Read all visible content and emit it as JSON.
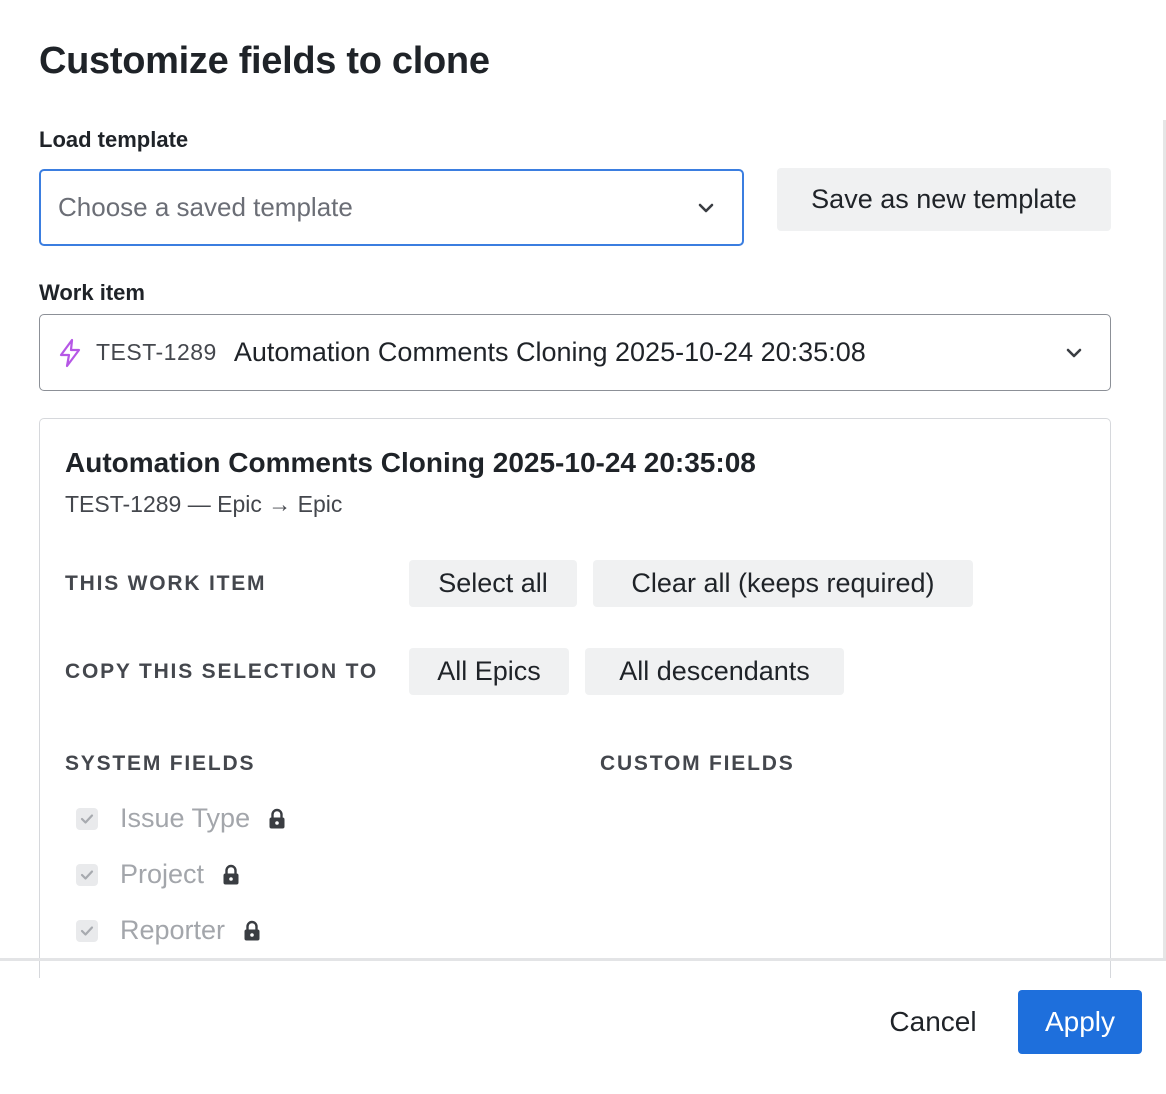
{
  "dialog": {
    "title": "Customize fields to clone"
  },
  "load_template": {
    "label": "Load template",
    "placeholder": "Choose a saved template",
    "save_button": "Save as new template"
  },
  "work_item": {
    "label": "Work item",
    "icon": "lightning-bolt-icon",
    "key": "TEST-1289",
    "name": "Automation Comments Cloning 2025-10-24 20:35:08"
  },
  "panel": {
    "title": "Automation Comments Cloning 2025-10-24 20:35:08",
    "subtitle": "TEST-1289 — Epic → Epic",
    "this_work_item_label": "THIS WORK ITEM",
    "select_all": "Select all",
    "clear_all": "Clear all (keeps required)",
    "copy_selection_label": "COPY THIS SELECTION TO",
    "all_epics": "All Epics",
    "all_descendants": "All descendants",
    "system_fields_label": "SYSTEM FIELDS",
    "custom_fields_label": "CUSTOM FIELDS",
    "system_fields": [
      {
        "label": "Issue Type",
        "checked": true,
        "locked": true
      },
      {
        "label": "Project",
        "checked": true,
        "locked": true
      },
      {
        "label": "Reporter",
        "checked": true,
        "locked": true
      }
    ]
  },
  "footer": {
    "cancel": "Cancel",
    "apply": "Apply"
  },
  "colors": {
    "primary": "#1e6fdc",
    "focus_border": "#3b7ee0",
    "bolt_icon": "#b657e6"
  }
}
